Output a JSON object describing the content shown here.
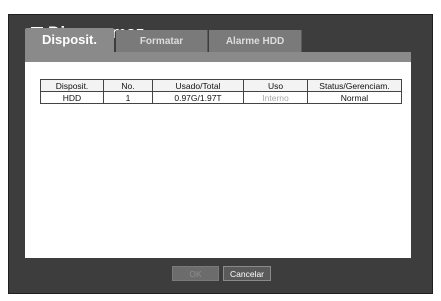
{
  "window": {
    "title": "Disp. armaz.",
    "icon": "storage-icon"
  },
  "tabs": [
    {
      "label": "Disposit.",
      "active": true
    },
    {
      "label": "Formatar",
      "active": false
    },
    {
      "label": "Alarme HDD",
      "active": false
    }
  ],
  "table": {
    "headers": [
      "Disposit.",
      "No.",
      "Usado/Total",
      "Uso",
      "Status/Gerenciam."
    ],
    "rows": [
      {
        "device": "HDD",
        "no": "1",
        "used_total": "0.97G/1.97T",
        "usage": "Interno",
        "status": "Normal"
      }
    ]
  },
  "buttons": {
    "ok_label": "OK",
    "cancel_label": "Cancelar"
  },
  "colors": {
    "window_bg": "#3d3d3d",
    "tab_active": "#8a8a8a",
    "tab_inactive": "#7a7a7a",
    "panel_bg": "#ffffff"
  }
}
